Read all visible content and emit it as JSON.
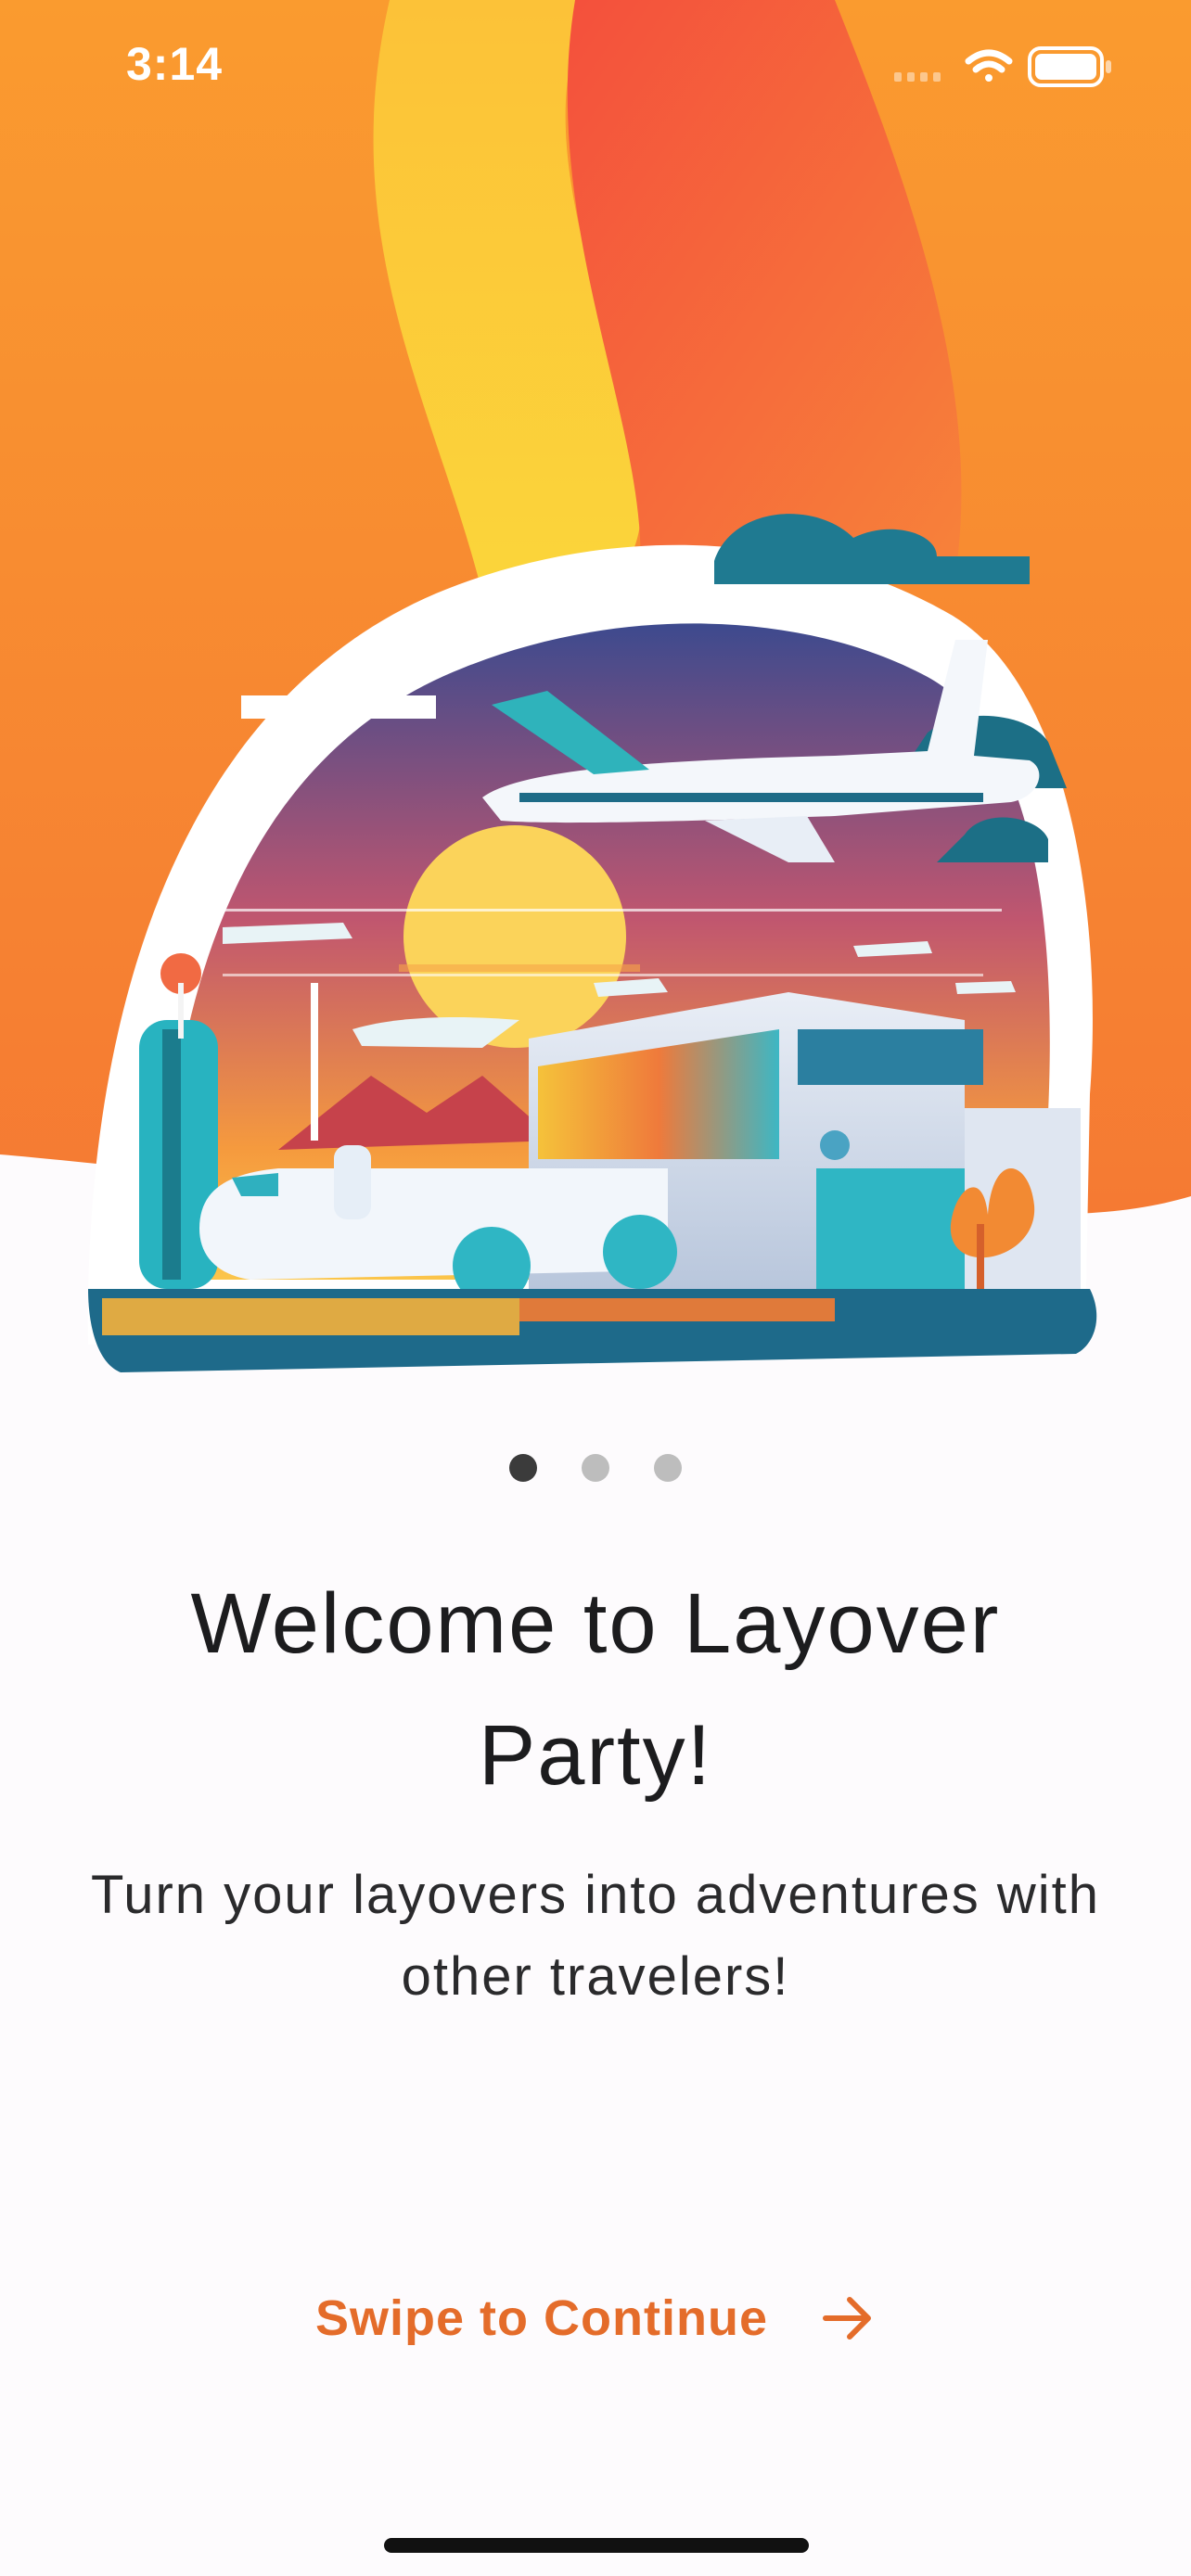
{
  "status_bar": {
    "time": "3:14",
    "icons": [
      "signal-icon",
      "wifi-icon",
      "battery-icon"
    ]
  },
  "hero": {
    "image": "airport-illustration",
    "colors": {
      "orange": "#f98a36",
      "red_orange": "#f4563b",
      "yellow": "#fcd339"
    }
  },
  "pager": {
    "count": 3,
    "active_index": 0
  },
  "onboarding": {
    "title": "Welcome to Layover Party!",
    "subtitle": "Turn your layovers into adventures with other travelers!"
  },
  "cta": {
    "label": "Swipe to Continue",
    "icon": "arrow-right-icon",
    "color": "#e46c2a"
  }
}
